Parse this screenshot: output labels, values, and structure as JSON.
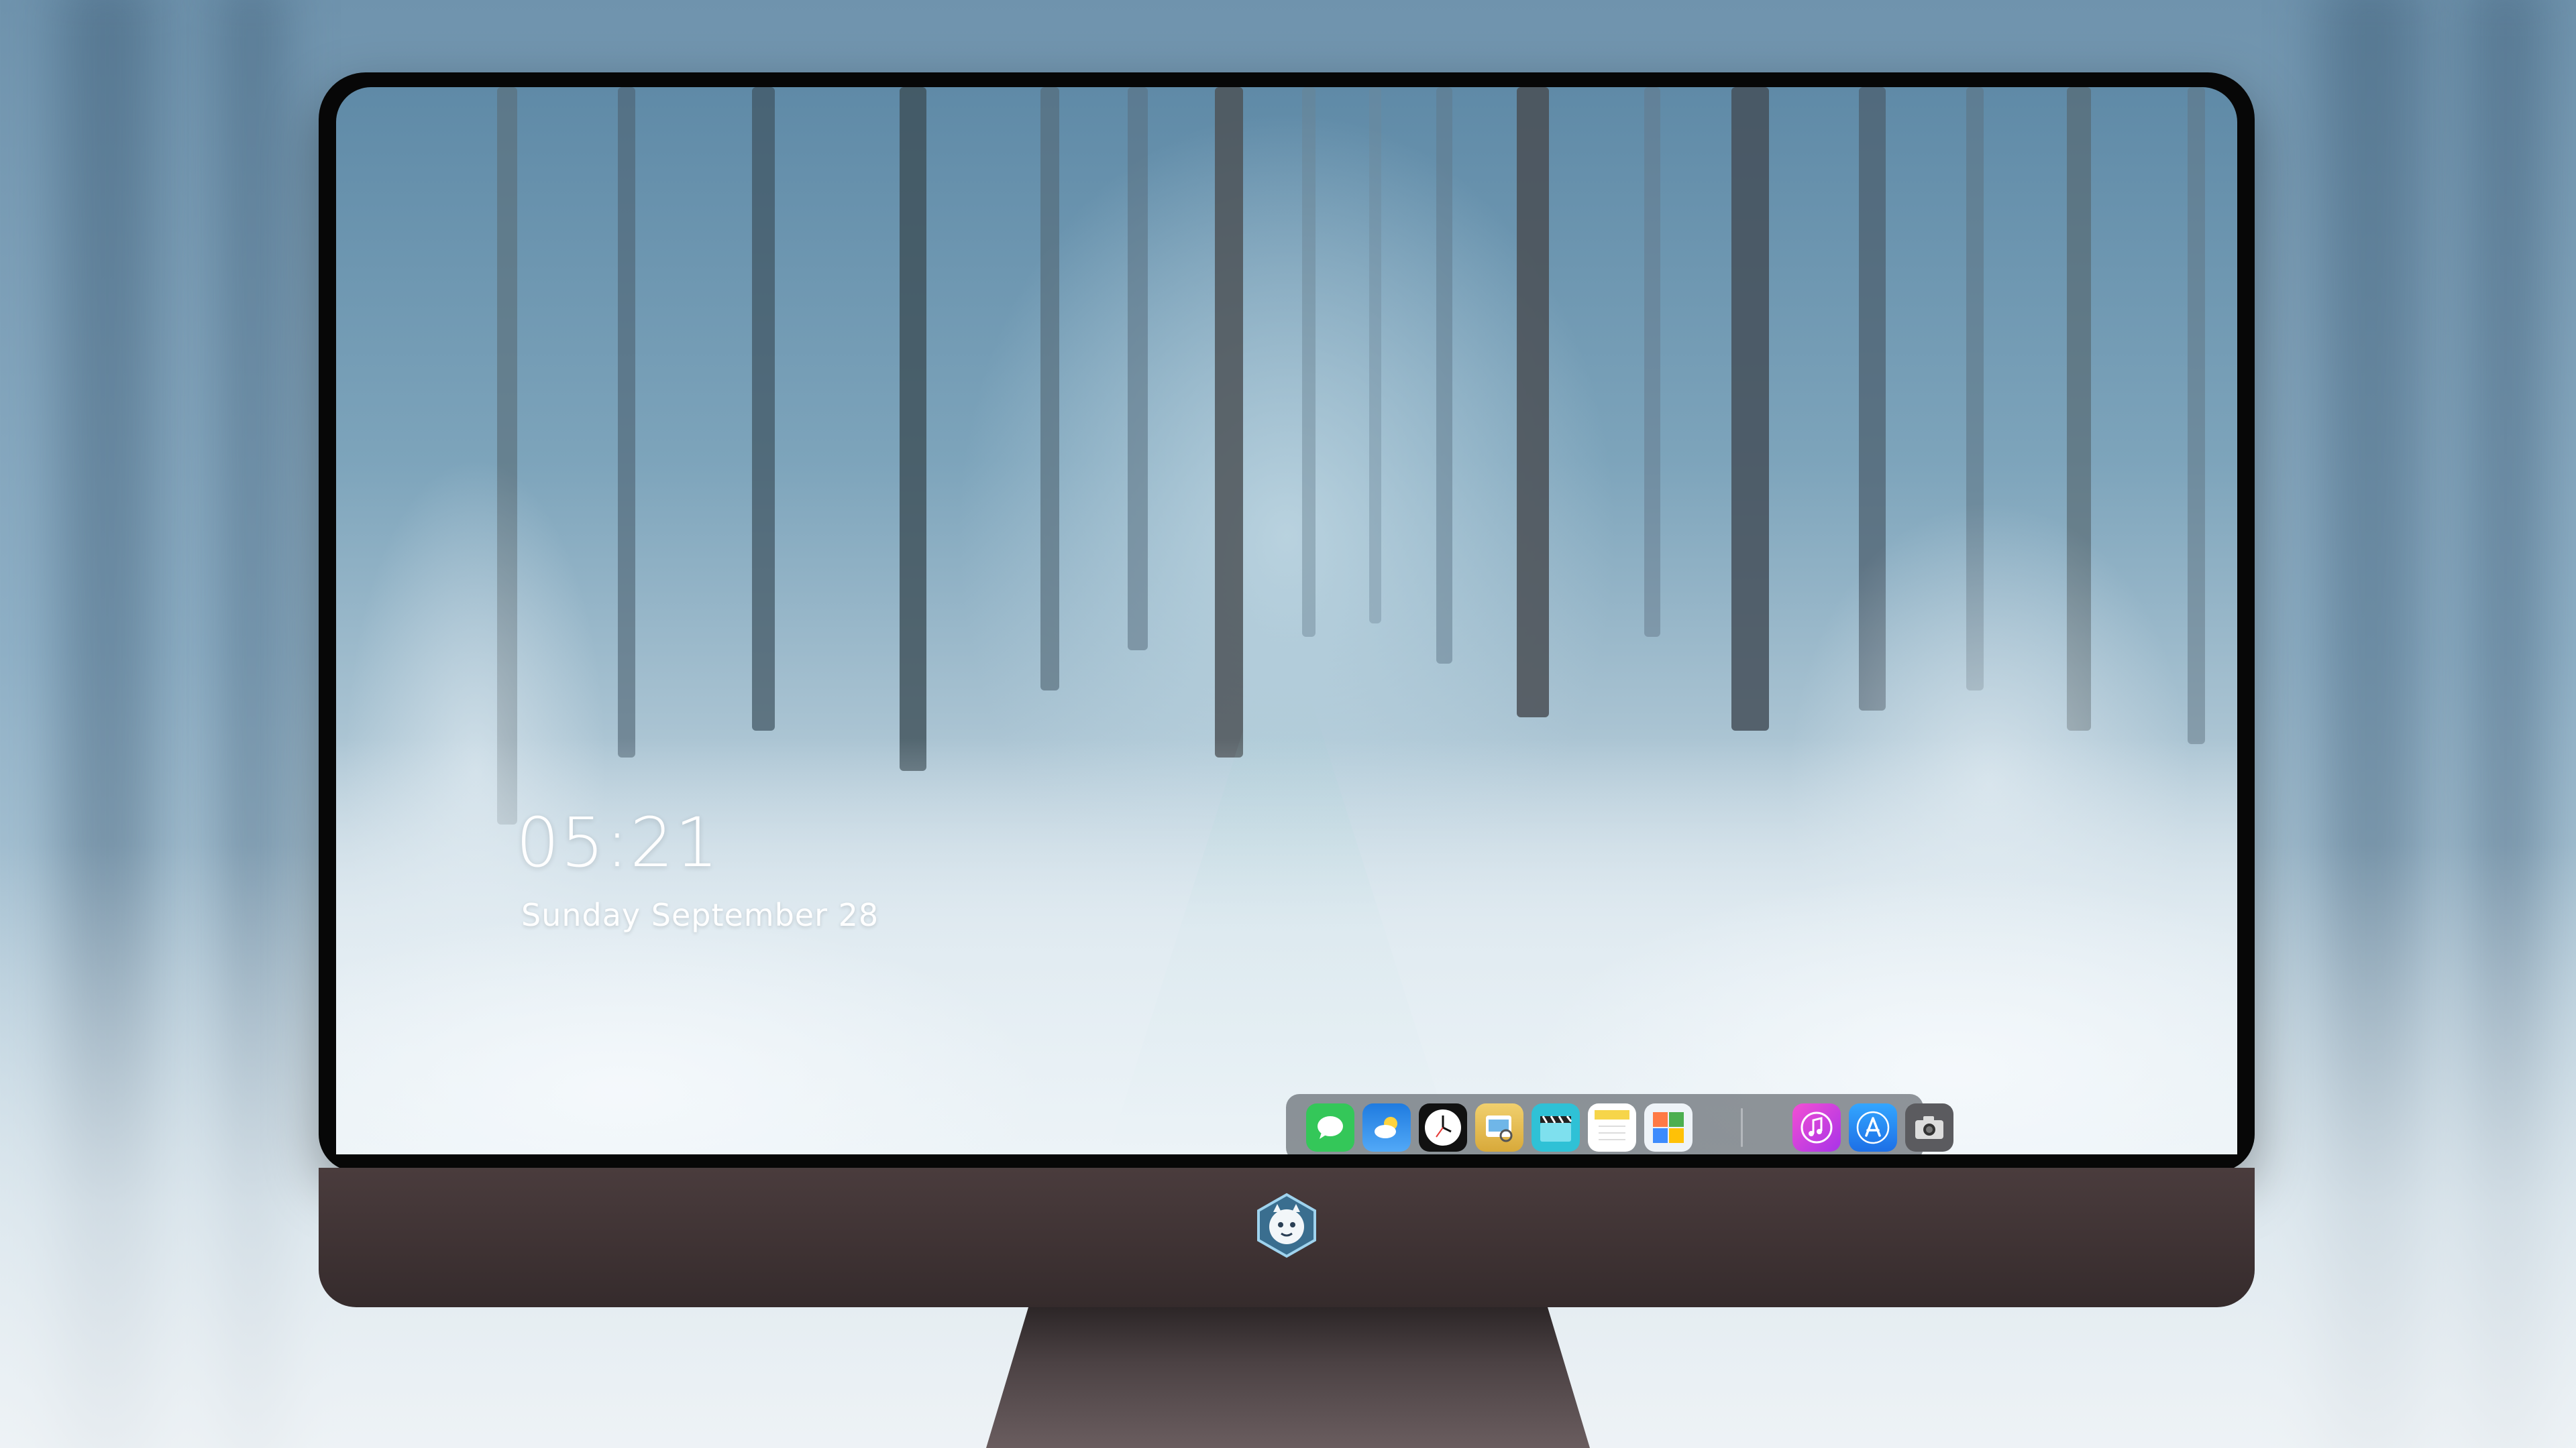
{
  "lock_screen": {
    "time": "05:21",
    "date": "Sunday September 28"
  },
  "dock": {
    "apps": [
      {
        "name": "messages-icon",
        "color": "#34c759"
      },
      {
        "name": "weather-icon",
        "color": "#2f8ff0"
      },
      {
        "name": "clock-icon",
        "color": "#111111"
      },
      {
        "name": "preview-icon",
        "color": "#e9c45a"
      },
      {
        "name": "clapperboard-icon",
        "color": "#34c5d8"
      },
      {
        "name": "notes-icon",
        "color": "#f6d54a"
      },
      {
        "name": "photo-gallery-icon",
        "color": "#5ab4ff"
      },
      {
        "name": "music-icon",
        "color": "#e048d0"
      },
      {
        "name": "app-store-icon",
        "color": "#2a8af5"
      },
      {
        "name": "camera-icon",
        "color": "#5b5b5f"
      }
    ]
  },
  "colors": {
    "bezel": "#070707",
    "chin": "#3e3233",
    "accent_sky": "#7da4bb"
  }
}
